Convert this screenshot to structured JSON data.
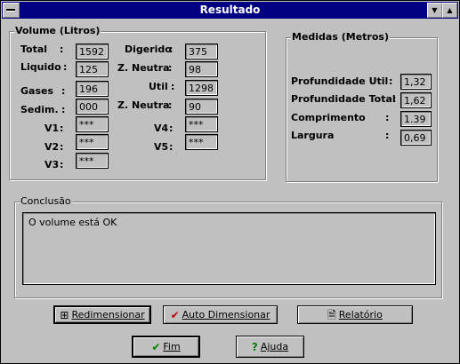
{
  "window": {
    "title": "Resultado"
  },
  "volume": {
    "title": "Volume (Litros)",
    "left": [
      {
        "label": "Total",
        "value": "1592"
      },
      {
        "label": "Liquido",
        "value": "125"
      },
      {
        "label": "Gases",
        "value": "196"
      },
      {
        "label": "Sedim.",
        "value": "000"
      },
      {
        "label": "V1",
        "value": "***"
      },
      {
        "label": "V2",
        "value": "***"
      },
      {
        "label": "V3",
        "value": "***"
      }
    ],
    "right": [
      {
        "label": "Digerido",
        "value": "375"
      },
      {
        "label": "Z. Neutra",
        "value": "98"
      },
      {
        "label": "Util",
        "value": "1298"
      },
      {
        "label": "Z. Neutra",
        "value": "90"
      },
      {
        "label": "V4",
        "value": "***"
      },
      {
        "label": "V5",
        "value": "***"
      }
    ]
  },
  "medidas": {
    "title": "Medidas (Metros)",
    "rows": [
      {
        "label": "Profundidade Util",
        "value": "1,32"
      },
      {
        "label": "Profundidade Total",
        "value": "1,62"
      },
      {
        "label": "Comprimento",
        "value": "1.39"
      },
      {
        "label": "Largura",
        "value": "0,69"
      }
    ]
  },
  "conclusao": {
    "title": "Conclusão",
    "text": "O volume está OK"
  },
  "buttons": {
    "redimensionar": "Redimensionar",
    "auto": "Auto Dimensionar",
    "relatorio": "Relatório",
    "fim": "Fim",
    "ajuda": "Ajuda"
  }
}
